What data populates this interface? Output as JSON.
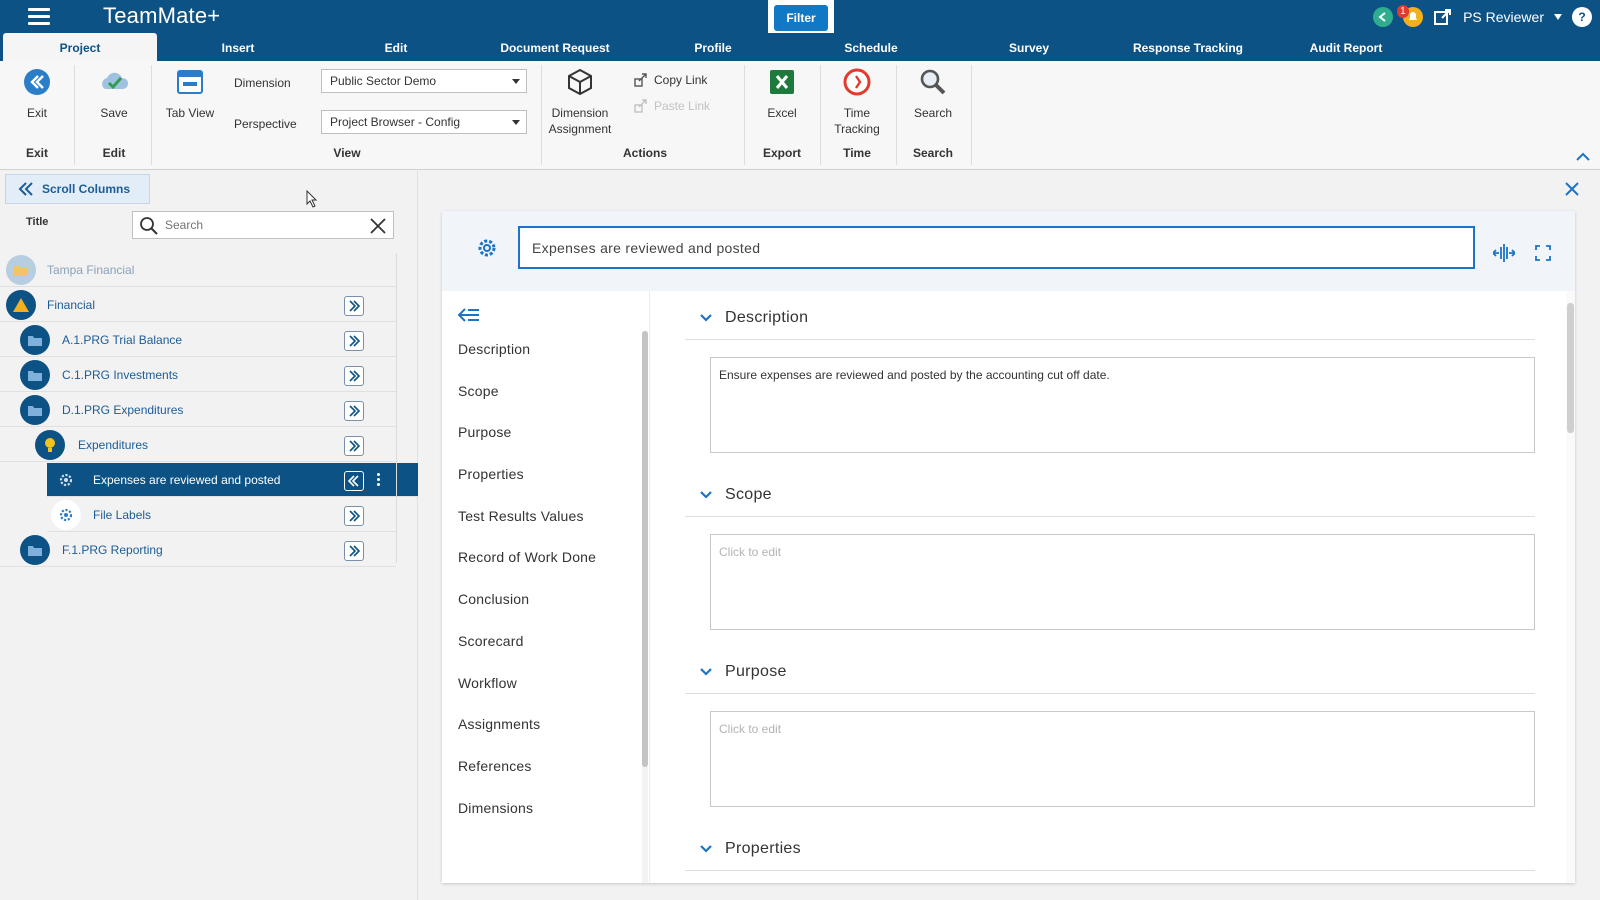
{
  "app": {
    "title": "TeamMate+",
    "filter_label": "Filter",
    "user": "PS Reviewer",
    "notification_count": "1"
  },
  "tabs": [
    {
      "label": "Project",
      "active": true
    },
    {
      "label": "Insert"
    },
    {
      "label": "Edit"
    },
    {
      "label": "Document Request"
    },
    {
      "label": "Profile"
    },
    {
      "label": "Schedule"
    },
    {
      "label": "Survey"
    },
    {
      "label": "Response Tracking"
    },
    {
      "label": "Audit Report"
    }
  ],
  "ribbon": {
    "exit": {
      "button": "Exit",
      "group": "Exit"
    },
    "save": {
      "button": "Save",
      "group": "Edit"
    },
    "tab_view": "Tab View",
    "view": {
      "group": "View",
      "dimension_label": "Dimension",
      "dimension_value": "Public Sector Demo",
      "perspective_label": "Perspective",
      "perspective_value": "Project Browser - Config"
    },
    "actions": {
      "group": "Actions",
      "dimension_assignment_1": "Dimension",
      "dimension_assignment_2": "Assignment",
      "copy_link": "Copy Link",
      "paste_link": "Paste Link"
    },
    "export": {
      "button": "Excel",
      "group": "Export"
    },
    "time": {
      "button_1": "Time",
      "button_2": "Tracking",
      "group": "Time"
    },
    "search": {
      "button": "Search",
      "group": "Search"
    }
  },
  "left": {
    "scroll_columns": "Scroll Columns",
    "column_title": "Title",
    "search_placeholder": "Search",
    "tree": [
      {
        "label": "Tampa Financial"
      },
      {
        "label": "Financial"
      },
      {
        "label": "A.1.PRG Trial Balance"
      },
      {
        "label": "C.1.PRG Investments"
      },
      {
        "label": "D.1.PRG Expenditures"
      },
      {
        "label": "Expenditures"
      },
      {
        "label": "Expenses are reviewed and posted"
      },
      {
        "label": "File Labels"
      },
      {
        "label": "F.1.PRG Reporting"
      }
    ]
  },
  "detail": {
    "title": "Expenses are reviewed and posted",
    "nav": [
      "Description",
      "Scope",
      "Purpose",
      "Properties",
      "Test Results Values",
      "Record of Work Done",
      "Conclusion",
      "Scorecard",
      "Workflow",
      "Assignments",
      "References",
      "Dimensions"
    ],
    "sections": [
      {
        "heading": "Description",
        "text": "Ensure expenses are reviewed and posted by the accounting cut off date."
      },
      {
        "heading": "Scope",
        "text": "Click to edit"
      },
      {
        "heading": "Purpose",
        "text": "Click to edit"
      },
      {
        "heading": "Properties"
      }
    ]
  },
  "colors": {
    "brand": "#0d5285",
    "accent": "#1d73c6",
    "link": "#1d5c96",
    "excel": "#1e7a3c",
    "time": "#e23b2e"
  }
}
